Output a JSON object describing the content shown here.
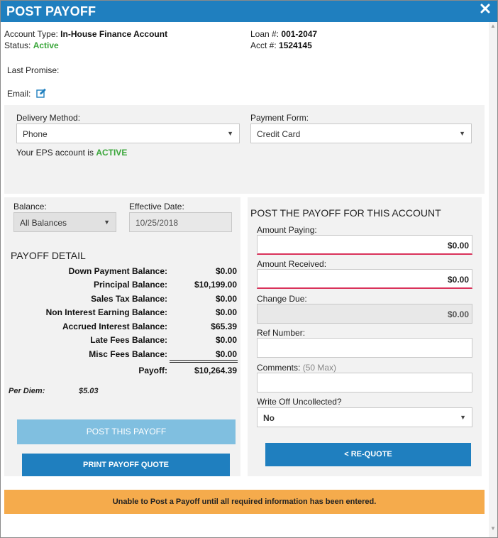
{
  "window": {
    "title": "POST PAYOFF"
  },
  "account": {
    "type_label": "Account Type:",
    "type_value": "In-House Finance Account",
    "status_label": "Status:",
    "status_value": "Active",
    "loan_label": "Loan #:",
    "loan_value": "001-2047",
    "acct_label": "Acct #:",
    "acct_value": "1524145",
    "last_promise_label": "Last Promise:",
    "email_label": "Email:"
  },
  "delivery": {
    "method_label": "Delivery Method:",
    "method_value": "Phone",
    "payment_form_label": "Payment Form:",
    "payment_form_value": "Credit Card",
    "eps_text": "Your EPS account is",
    "eps_status": "ACTIVE"
  },
  "balance": {
    "label": "Balance:",
    "value": "All Balances",
    "effective_date_label": "Effective Date:",
    "effective_date_value": "10/25/2018"
  },
  "payoff_detail": {
    "heading": "PAYOFF DETAIL",
    "rows": [
      {
        "label": "Down Payment Balance:",
        "value": "$0.00"
      },
      {
        "label": "Principal Balance:",
        "value": "$10,199.00"
      },
      {
        "label": "Sales Tax Balance:",
        "value": "$0.00"
      },
      {
        "label": "Non Interest Earning Balance:",
        "value": "$0.00"
      },
      {
        "label": "Accrued Interest Balance:",
        "value": "$65.39"
      },
      {
        "label": "Late Fees Balance:",
        "value": "$0.00"
      },
      {
        "label": "Misc Fees Balance:",
        "value": "$0.00"
      }
    ],
    "payoff_label": "Payoff:",
    "payoff_value": "$10,264.39",
    "per_diem_label": "Per Diem:",
    "per_diem_value": "$5.03"
  },
  "buttons": {
    "post_payoff": "POST THIS PAYOFF",
    "print_quote": "PRINT PAYOFF QUOTE",
    "requote": "< RE-QUOTE"
  },
  "post_form": {
    "heading": "POST THE PAYOFF FOR THIS ACCOUNT",
    "amount_paying_label": "Amount Paying:",
    "amount_paying_value": "$0.00",
    "amount_received_label": "Amount Received:",
    "amount_received_value": "$0.00",
    "change_due_label": "Change Due:",
    "change_due_value": "$0.00",
    "ref_number_label": "Ref Number:",
    "ref_number_value": "",
    "comments_label": "Comments:",
    "comments_hint": "(50 Max)",
    "comments_value": "",
    "write_off_label": "Write Off Uncollected?",
    "write_off_value": "No"
  },
  "warning": {
    "text": "Unable to Post a Payoff until all required information has been entered."
  },
  "colors": {
    "header_blue": "#1f7fbf",
    "light_blue": "#80bfe0",
    "active_green": "#3aa63a",
    "warning_orange": "#f5ab4c",
    "required_red": "#d9325a"
  },
  "icons": [
    "close-icon",
    "edit-icon",
    "chevron-down-icon",
    "scroll-up-icon",
    "scroll-down-icon"
  ]
}
